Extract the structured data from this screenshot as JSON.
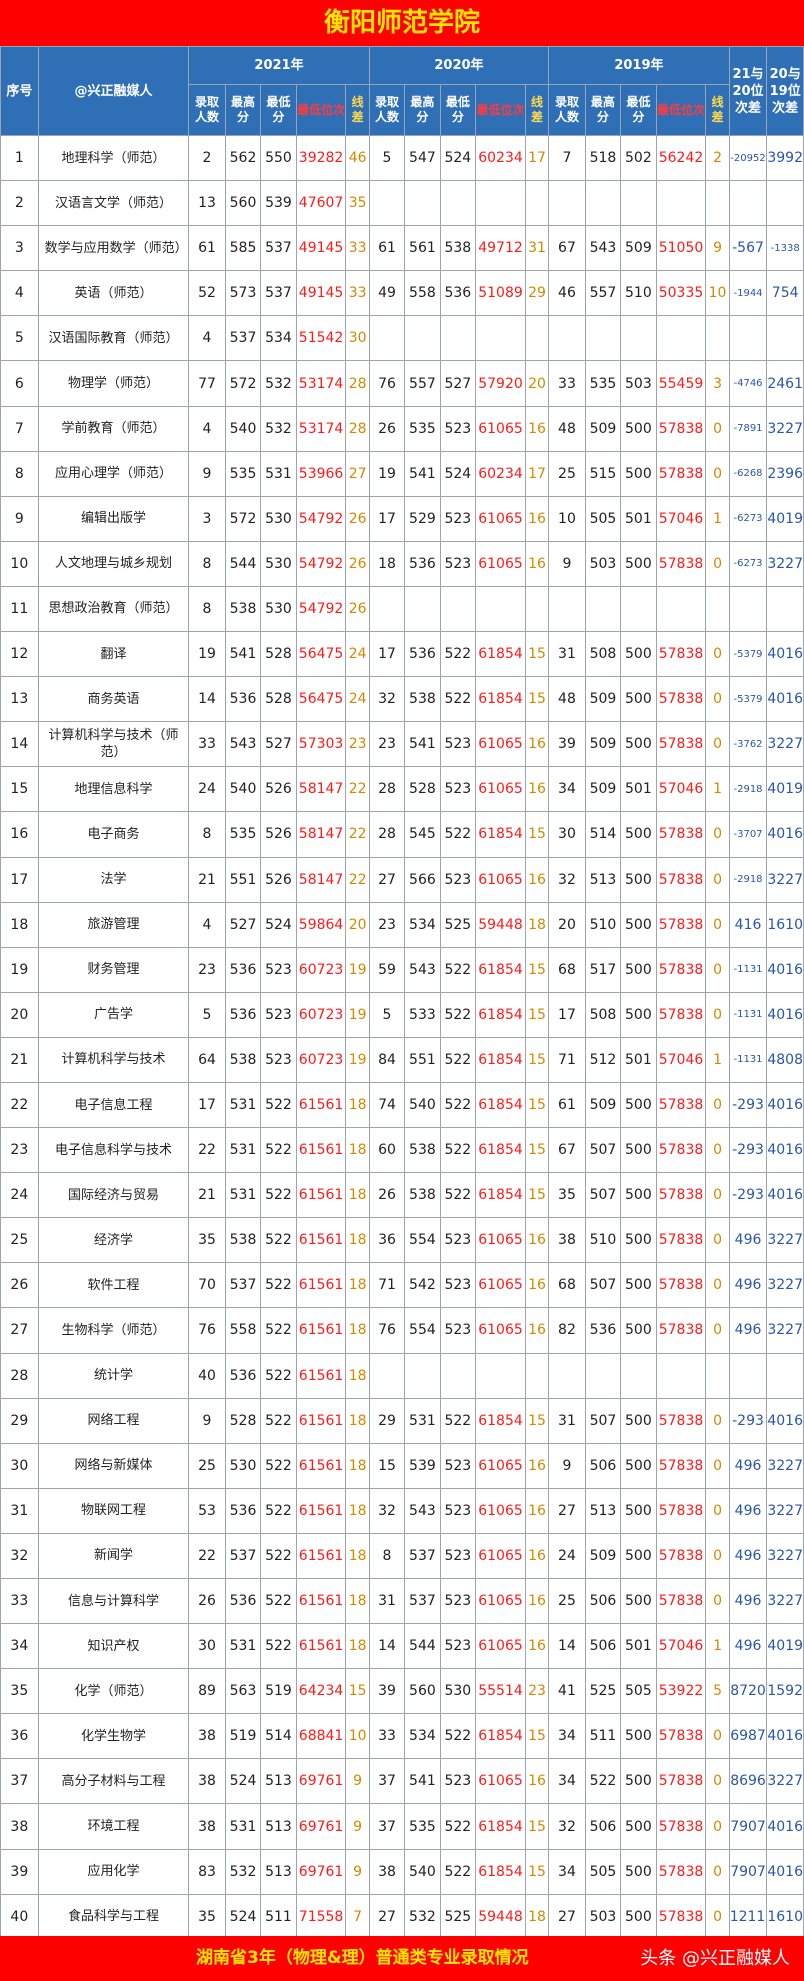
{
  "page_title": "衡阳师范学院",
  "footer": {
    "caption": "湖南省3年（物理&理）普通类专业录取情况",
    "brand": "头条 @兴正融媒人"
  },
  "header": {
    "seq": "序号",
    "major": "@兴正融媒人",
    "years": [
      "2021年",
      "2020年",
      "2019年"
    ],
    "sub": [
      "录取人数",
      "最高分",
      "最低分",
      "最低位次",
      "线差"
    ],
    "cmp1": "21与20位次差",
    "cmp2": "20与19位次差"
  },
  "rows": [
    {
      "no": "1",
      "major": "地理科学（师范）",
      "y21": [
        "2",
        "562",
        "550",
        "39282",
        "46"
      ],
      "y20": [
        "5",
        "547",
        "524",
        "60234",
        "17"
      ],
      "y19": [
        "7",
        "518",
        "502",
        "56242",
        "2"
      ],
      "d1": "-20952",
      "d2": "3992"
    },
    {
      "no": "2",
      "major": "汉语言文学（师范）",
      "y21": [
        "13",
        "560",
        "539",
        "47607",
        "35"
      ],
      "y20": [
        "",
        "",
        "",
        "",
        ""
      ],
      "y19": [
        "",
        "",
        "",
        "",
        ""
      ],
      "d1": "",
      "d2": ""
    },
    {
      "no": "3",
      "major": "数学与应用数学（师范）",
      "y21": [
        "61",
        "585",
        "537",
        "49145",
        "33"
      ],
      "y20": [
        "61",
        "561",
        "538",
        "49712",
        "31"
      ],
      "y19": [
        "67",
        "543",
        "509",
        "51050",
        "9"
      ],
      "d1": "-567",
      "d2": "-1338"
    },
    {
      "no": "4",
      "major": "英语（师范）",
      "y21": [
        "52",
        "573",
        "537",
        "49145",
        "33"
      ],
      "y20": [
        "49",
        "558",
        "536",
        "51089",
        "29"
      ],
      "y19": [
        "46",
        "557",
        "510",
        "50335",
        "10"
      ],
      "d1": "-1944",
      "d2": "754"
    },
    {
      "no": "5",
      "major": "汉语国际教育（师范）",
      "y21": [
        "4",
        "537",
        "534",
        "51542",
        "30"
      ],
      "y20": [
        "",
        "",
        "",
        "",
        ""
      ],
      "y19": [
        "",
        "",
        "",
        "",
        ""
      ],
      "d1": "",
      "d2": ""
    },
    {
      "no": "6",
      "major": "物理学（师范）",
      "y21": [
        "77",
        "572",
        "532",
        "53174",
        "28"
      ],
      "y20": [
        "76",
        "557",
        "527",
        "57920",
        "20"
      ],
      "y19": [
        "33",
        "535",
        "503",
        "55459",
        "3"
      ],
      "d1": "-4746",
      "d2": "2461"
    },
    {
      "no": "7",
      "major": "学前教育（师范）",
      "y21": [
        "4",
        "540",
        "532",
        "53174",
        "28"
      ],
      "y20": [
        "26",
        "535",
        "523",
        "61065",
        "16"
      ],
      "y19": [
        "48",
        "509",
        "500",
        "57838",
        "0"
      ],
      "d1": "-7891",
      "d2": "3227"
    },
    {
      "no": "8",
      "major": "应用心理学（师范）",
      "y21": [
        "9",
        "535",
        "531",
        "53966",
        "27"
      ],
      "y20": [
        "19",
        "541",
        "524",
        "60234",
        "17"
      ],
      "y19": [
        "25",
        "515",
        "500",
        "57838",
        "0"
      ],
      "d1": "-6268",
      "d2": "2396"
    },
    {
      "no": "9",
      "major": "编辑出版学",
      "y21": [
        "3",
        "572",
        "530",
        "54792",
        "26"
      ],
      "y20": [
        "17",
        "529",
        "523",
        "61065",
        "16"
      ],
      "y19": [
        "10",
        "505",
        "501",
        "57046",
        "1"
      ],
      "d1": "-6273",
      "d2": "4019"
    },
    {
      "no": "10",
      "major": "人文地理与城乡规划",
      "y21": [
        "8",
        "544",
        "530",
        "54792",
        "26"
      ],
      "y20": [
        "18",
        "536",
        "523",
        "61065",
        "16"
      ],
      "y19": [
        "9",
        "503",
        "500",
        "57838",
        "0"
      ],
      "d1": "-6273",
      "d2": "3227"
    },
    {
      "no": "11",
      "major": "思想政治教育（师范）",
      "y21": [
        "8",
        "538",
        "530",
        "54792",
        "26"
      ],
      "y20": [
        "",
        "",
        "",
        "",
        ""
      ],
      "y19": [
        "",
        "",
        "",
        "",
        ""
      ],
      "d1": "",
      "d2": ""
    },
    {
      "no": "12",
      "major": "翻译",
      "y21": [
        "19",
        "541",
        "528",
        "56475",
        "24"
      ],
      "y20": [
        "17",
        "536",
        "522",
        "61854",
        "15"
      ],
      "y19": [
        "31",
        "508",
        "500",
        "57838",
        "0"
      ],
      "d1": "-5379",
      "d2": "4016"
    },
    {
      "no": "13",
      "major": "商务英语",
      "y21": [
        "14",
        "536",
        "528",
        "56475",
        "24"
      ],
      "y20": [
        "32",
        "538",
        "522",
        "61854",
        "15"
      ],
      "y19": [
        "48",
        "509",
        "500",
        "57838",
        "0"
      ],
      "d1": "-5379",
      "d2": "4016"
    },
    {
      "no": "14",
      "major": "计算机科学与技术（师范）",
      "y21": [
        "33",
        "543",
        "527",
        "57303",
        "23"
      ],
      "y20": [
        "23",
        "541",
        "523",
        "61065",
        "16"
      ],
      "y19": [
        "39",
        "509",
        "500",
        "57838",
        "0"
      ],
      "d1": "-3762",
      "d2": "3227"
    },
    {
      "no": "15",
      "major": "地理信息科学",
      "y21": [
        "24",
        "540",
        "526",
        "58147",
        "22"
      ],
      "y20": [
        "28",
        "528",
        "523",
        "61065",
        "16"
      ],
      "y19": [
        "34",
        "509",
        "501",
        "57046",
        "1"
      ],
      "d1": "-2918",
      "d2": "4019"
    },
    {
      "no": "16",
      "major": "电子商务",
      "y21": [
        "8",
        "535",
        "526",
        "58147",
        "22"
      ],
      "y20": [
        "28",
        "545",
        "522",
        "61854",
        "15"
      ],
      "y19": [
        "30",
        "514",
        "500",
        "57838",
        "0"
      ],
      "d1": "-3707",
      "d2": "4016"
    },
    {
      "no": "17",
      "major": "法学",
      "y21": [
        "21",
        "551",
        "526",
        "58147",
        "22"
      ],
      "y20": [
        "27",
        "566",
        "523",
        "61065",
        "16"
      ],
      "y19": [
        "32",
        "513",
        "500",
        "57838",
        "0"
      ],
      "d1": "-2918",
      "d2": "3227"
    },
    {
      "no": "18",
      "major": "旅游管理",
      "y21": [
        "4",
        "527",
        "524",
        "59864",
        "20"
      ],
      "y20": [
        "23",
        "534",
        "525",
        "59448",
        "18"
      ],
      "y19": [
        "20",
        "510",
        "500",
        "57838",
        "0"
      ],
      "d1": "416",
      "d2": "1610"
    },
    {
      "no": "19",
      "major": "财务管理",
      "y21": [
        "23",
        "536",
        "523",
        "60723",
        "19"
      ],
      "y20": [
        "59",
        "543",
        "522",
        "61854",
        "15"
      ],
      "y19": [
        "68",
        "517",
        "500",
        "57838",
        "0"
      ],
      "d1": "-1131",
      "d2": "4016"
    },
    {
      "no": "20",
      "major": "广告学",
      "y21": [
        "5",
        "536",
        "523",
        "60723",
        "19"
      ],
      "y20": [
        "5",
        "533",
        "522",
        "61854",
        "15"
      ],
      "y19": [
        "17",
        "508",
        "500",
        "57838",
        "0"
      ],
      "d1": "-1131",
      "d2": "4016"
    },
    {
      "no": "21",
      "major": "计算机科学与技术",
      "y21": [
        "64",
        "538",
        "523",
        "60723",
        "19"
      ],
      "y20": [
        "84",
        "551",
        "522",
        "61854",
        "15"
      ],
      "y19": [
        "71",
        "512",
        "501",
        "57046",
        "1"
      ],
      "d1": "-1131",
      "d2": "4808"
    },
    {
      "no": "22",
      "major": "电子信息工程",
      "y21": [
        "17",
        "531",
        "522",
        "61561",
        "18"
      ],
      "y20": [
        "74",
        "540",
        "522",
        "61854",
        "15"
      ],
      "y19": [
        "61",
        "509",
        "500",
        "57838",
        "0"
      ],
      "d1": "-293",
      "d2": "4016"
    },
    {
      "no": "23",
      "major": "电子信息科学与技术",
      "y21": [
        "22",
        "531",
        "522",
        "61561",
        "18"
      ],
      "y20": [
        "60",
        "538",
        "522",
        "61854",
        "15"
      ],
      "y19": [
        "67",
        "507",
        "500",
        "57838",
        "0"
      ],
      "d1": "-293",
      "d2": "4016"
    },
    {
      "no": "24",
      "major": "国际经济与贸易",
      "y21": [
        "21",
        "531",
        "522",
        "61561",
        "18"
      ],
      "y20": [
        "26",
        "538",
        "522",
        "61854",
        "15"
      ],
      "y19": [
        "35",
        "507",
        "500",
        "57838",
        "0"
      ],
      "d1": "-293",
      "d2": "4016"
    },
    {
      "no": "25",
      "major": "经济学",
      "y21": [
        "35",
        "538",
        "522",
        "61561",
        "18"
      ],
      "y20": [
        "36",
        "554",
        "523",
        "61065",
        "16"
      ],
      "y19": [
        "38",
        "510",
        "500",
        "57838",
        "0"
      ],
      "d1": "496",
      "d2": "3227"
    },
    {
      "no": "26",
      "major": "软件工程",
      "y21": [
        "70",
        "537",
        "522",
        "61561",
        "18"
      ],
      "y20": [
        "71",
        "542",
        "523",
        "61065",
        "16"
      ],
      "y19": [
        "68",
        "507",
        "500",
        "57838",
        "0"
      ],
      "d1": "496",
      "d2": "3227"
    },
    {
      "no": "27",
      "major": "生物科学（师范）",
      "y21": [
        "76",
        "558",
        "522",
        "61561",
        "18"
      ],
      "y20": [
        "76",
        "554",
        "523",
        "61065",
        "16"
      ],
      "y19": [
        "82",
        "536",
        "500",
        "57838",
        "0"
      ],
      "d1": "496",
      "d2": "3227"
    },
    {
      "no": "28",
      "major": "统计学",
      "y21": [
        "40",
        "536",
        "522",
        "61561",
        "18"
      ],
      "y20": [
        "",
        "",
        "",
        "",
        ""
      ],
      "y19": [
        "",
        "",
        "",
        "",
        ""
      ],
      "d1": "",
      "d2": ""
    },
    {
      "no": "29",
      "major": "网络工程",
      "y21": [
        "9",
        "528",
        "522",
        "61561",
        "18"
      ],
      "y20": [
        "29",
        "531",
        "522",
        "61854",
        "15"
      ],
      "y19": [
        "31",
        "507",
        "500",
        "57838",
        "0"
      ],
      "d1": "-293",
      "d2": "4016"
    },
    {
      "no": "30",
      "major": "网络与新媒体",
      "y21": [
        "25",
        "530",
        "522",
        "61561",
        "18"
      ],
      "y20": [
        "15",
        "539",
        "523",
        "61065",
        "16"
      ],
      "y19": [
        "9",
        "506",
        "500",
        "57838",
        "0"
      ],
      "d1": "496",
      "d2": "3227"
    },
    {
      "no": "31",
      "major": "物联网工程",
      "y21": [
        "53",
        "536",
        "522",
        "61561",
        "18"
      ],
      "y20": [
        "32",
        "543",
        "523",
        "61065",
        "16"
      ],
      "y19": [
        "27",
        "513",
        "500",
        "57838",
        "0"
      ],
      "d1": "496",
      "d2": "3227"
    },
    {
      "no": "32",
      "major": "新闻学",
      "y21": [
        "22",
        "537",
        "522",
        "61561",
        "18"
      ],
      "y20": [
        "8",
        "537",
        "523",
        "61065",
        "16"
      ],
      "y19": [
        "24",
        "509",
        "500",
        "57838",
        "0"
      ],
      "d1": "496",
      "d2": "3227"
    },
    {
      "no": "33",
      "major": "信息与计算科学",
      "y21": [
        "26",
        "536",
        "522",
        "61561",
        "18"
      ],
      "y20": [
        "31",
        "537",
        "523",
        "61065",
        "16"
      ],
      "y19": [
        "25",
        "506",
        "500",
        "57838",
        "0"
      ],
      "d1": "496",
      "d2": "3227"
    },
    {
      "no": "34",
      "major": "知识产权",
      "y21": [
        "30",
        "531",
        "522",
        "61561",
        "18"
      ],
      "y20": [
        "14",
        "544",
        "523",
        "61065",
        "16"
      ],
      "y19": [
        "14",
        "506",
        "501",
        "57046",
        "1"
      ],
      "d1": "496",
      "d2": "4019"
    },
    {
      "no": "35",
      "major": "化学（师范）",
      "y21": [
        "89",
        "563",
        "519",
        "64234",
        "15"
      ],
      "y20": [
        "39",
        "560",
        "530",
        "55514",
        "23"
      ],
      "y19": [
        "41",
        "525",
        "505",
        "53922",
        "5"
      ],
      "d1": "8720",
      "d2": "1592"
    },
    {
      "no": "36",
      "major": "化学生物学",
      "y21": [
        "38",
        "519",
        "514",
        "68841",
        "10"
      ],
      "y20": [
        "33",
        "534",
        "522",
        "61854",
        "15"
      ],
      "y19": [
        "34",
        "511",
        "500",
        "57838",
        "0"
      ],
      "d1": "6987",
      "d2": "4016"
    },
    {
      "no": "37",
      "major": "高分子材料与工程",
      "y21": [
        "38",
        "524",
        "513",
        "69761",
        "9"
      ],
      "y20": [
        "37",
        "541",
        "523",
        "61065",
        "16"
      ],
      "y19": [
        "34",
        "522",
        "500",
        "57838",
        "0"
      ],
      "d1": "8696",
      "d2": "3227"
    },
    {
      "no": "38",
      "major": "环境工程",
      "y21": [
        "38",
        "531",
        "513",
        "69761",
        "9"
      ],
      "y20": [
        "37",
        "535",
        "522",
        "61854",
        "15"
      ],
      "y19": [
        "32",
        "506",
        "500",
        "57838",
        "0"
      ],
      "d1": "7907",
      "d2": "4016"
    },
    {
      "no": "39",
      "major": "应用化学",
      "y21": [
        "83",
        "532",
        "513",
        "69761",
        "9"
      ],
      "y20": [
        "38",
        "540",
        "522",
        "61854",
        "15"
      ],
      "y19": [
        "34",
        "505",
        "500",
        "57838",
        "0"
      ],
      "d1": "7907",
      "d2": "4016"
    },
    {
      "no": "40",
      "major": "食品科学与工程",
      "y21": [
        "35",
        "524",
        "511",
        "71558",
        "7"
      ],
      "y20": [
        "27",
        "532",
        "525",
        "59448",
        "18"
      ],
      "y19": [
        "27",
        "503",
        "500",
        "57838",
        "0"
      ],
      "d1": "12110",
      "d2": "1610"
    }
  ]
}
